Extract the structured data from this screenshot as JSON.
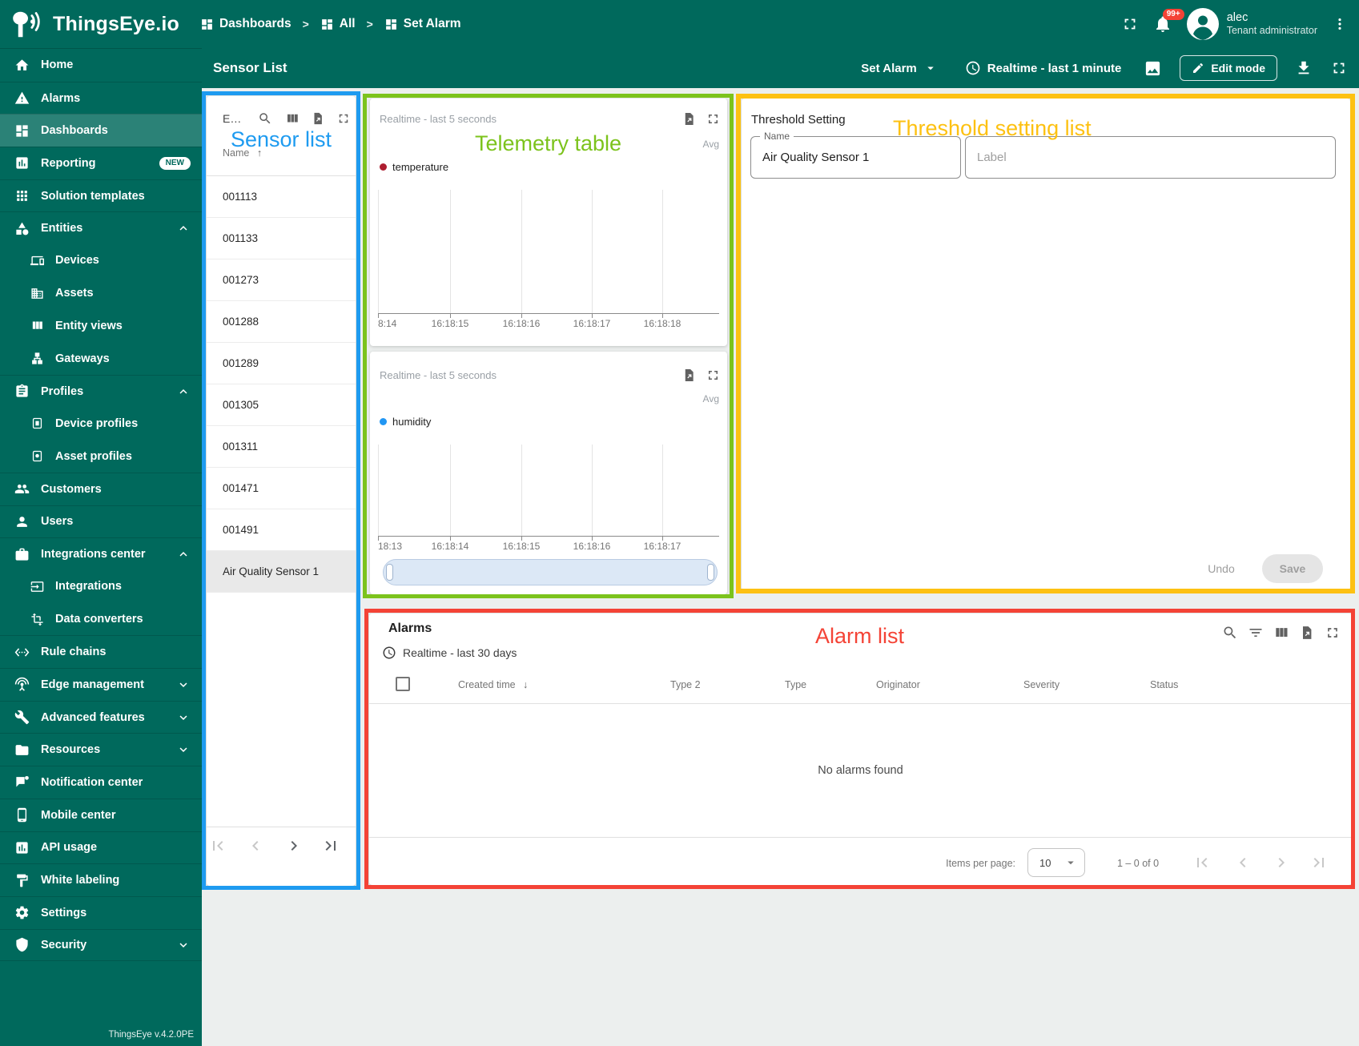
{
  "colors": {
    "brand_teal": "#00695c",
    "annotation_blue": "#1e9bf0",
    "annotation_green": "#7cc31c",
    "annotation_amber": "#fdc112",
    "annotation_red": "#f44336",
    "series_temperature": "#ad1d30",
    "series_humidity": "#2196f3",
    "notification_badge_red": "#f44336"
  },
  "brand": {
    "name": "ThingsEye.io",
    "version": "ThingsEye v.4.2.0PE"
  },
  "breadcrumbs": [
    {
      "label": "Dashboards"
    },
    {
      "label": "All"
    },
    {
      "label": "Set Alarm"
    }
  ],
  "topbar": {
    "notification_badge": "99+",
    "user_name": "alec",
    "user_role": "Tenant administrator"
  },
  "toolbar": {
    "title": "Sensor List",
    "state_selector": "Set Alarm",
    "timewindow": "Realtime - last 1 minute",
    "edit_mode_label": "Edit mode"
  },
  "sidebar": {
    "items": [
      {
        "label": "Home"
      },
      {
        "label": "Alarms"
      },
      {
        "label": "Dashboards",
        "active": true
      },
      {
        "label": "Reporting",
        "badge": "NEW"
      },
      {
        "label": "Solution templates"
      },
      {
        "label": "Entities",
        "chevron": "up"
      },
      {
        "label": "Devices",
        "sub": true
      },
      {
        "label": "Assets",
        "sub": true
      },
      {
        "label": "Entity views",
        "sub": true
      },
      {
        "label": "Gateways",
        "sub": true
      },
      {
        "label": "Profiles",
        "chevron": "up"
      },
      {
        "label": "Device profiles",
        "sub": true
      },
      {
        "label": "Asset profiles",
        "sub": true
      },
      {
        "label": "Customers"
      },
      {
        "label": "Users"
      },
      {
        "label": "Integrations center",
        "chevron": "up"
      },
      {
        "label": "Integrations",
        "sub": true
      },
      {
        "label": "Data converters",
        "sub": true
      },
      {
        "label": "Rule chains"
      },
      {
        "label": "Edge management",
        "chevron": "down"
      },
      {
        "label": "Advanced features",
        "chevron": "down"
      },
      {
        "label": "Resources",
        "chevron": "down"
      },
      {
        "label": "Notification center"
      },
      {
        "label": "Mobile center"
      },
      {
        "label": "API usage"
      },
      {
        "label": "White labeling"
      },
      {
        "label": "Settings"
      },
      {
        "label": "Security",
        "chevron": "down"
      }
    ]
  },
  "annotations": {
    "sensor_list": "Sensor list",
    "telemetry": "Telemetry table",
    "threshold": "Threshold setting list",
    "alarms": "Alarm list"
  },
  "sensor_list": {
    "title": "E…",
    "name_column": "Name",
    "sort": "asc",
    "rows": [
      "001113",
      "001133",
      "001273",
      "001288",
      "001289",
      "001305",
      "001311",
      "001471",
      "001491",
      "Air Quality Sensor 1"
    ],
    "selected_row": "Air Quality Sensor 1"
  },
  "chart_data": [
    {
      "type": "line",
      "timewindow": "Realtime - last 5 seconds",
      "agg_label": "Avg",
      "series": [
        {
          "name": "temperature",
          "color": "#ad1d30",
          "values": []
        }
      ],
      "xticks": [
        "8:14",
        "16:18:15",
        "16:18:16",
        "16:18:17",
        "16:18:18"
      ],
      "yticks": [],
      "grid": "vertical-gridlines-only",
      "legend_position": "top-left",
      "note": "empty plot - no data points rendered in the visible window"
    },
    {
      "type": "line",
      "timewindow": "Realtime - last 5 seconds",
      "agg_label": "Avg",
      "series": [
        {
          "name": "humidity",
          "color": "#2196f3",
          "values": []
        }
      ],
      "xticks": [
        "18:13",
        "16:18:14",
        "16:18:15",
        "16:18:16",
        "16:18:17"
      ],
      "yticks": [],
      "grid": "vertical-gridlines-only",
      "legend_position": "top-left",
      "has_datazoom_slider": true,
      "note": "empty plot - no data points rendered in the visible window"
    }
  ],
  "threshold": {
    "title": "Threshold Setting",
    "name_label": "Name",
    "name_value": "Air Quality Sensor 1",
    "label_placeholder": "Label",
    "undo_label": "Undo",
    "save_label": "Save"
  },
  "alarms": {
    "title": "Alarms",
    "timewindow": "Realtime - last 30 days",
    "columns": [
      "Created time",
      "Type 2",
      "Type",
      "Originator",
      "Severity",
      "Status"
    ],
    "empty_text": "No alarms found",
    "items_per_page_label": "Items per page:",
    "items_per_page_value": "10",
    "range_label": "1 – 0 of 0"
  }
}
